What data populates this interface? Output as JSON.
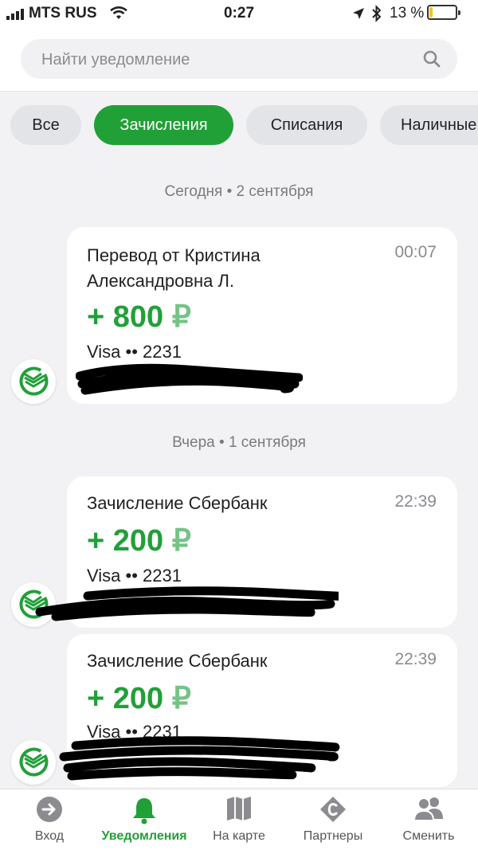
{
  "status_bar": {
    "carrier": "MTS RUS",
    "time": "0:27",
    "battery": "13 %",
    "battery_level": 0.13
  },
  "search": {
    "placeholder": "Найти уведомление",
    "value": ""
  },
  "filters": [
    {
      "label": "Все",
      "active": false
    },
    {
      "label": "Зачисления",
      "active": true
    },
    {
      "label": "Списания",
      "active": false
    },
    {
      "label": "Наличные",
      "active": false
    }
  ],
  "groups": [
    {
      "date": "Сегодня • 2 сентября",
      "items": [
        {
          "title_line1": "Перевод от Кристина",
          "title_line2": "Александровна Л.",
          "time": "00:07",
          "amount": "+ 800",
          "currency": "₽",
          "card": "Visa •• 2231"
        }
      ]
    },
    {
      "date": "Вчера • 1 сентября",
      "items": [
        {
          "title": "Зачисление Сбербанк",
          "time": "22:39",
          "amount": "+ 200",
          "currency": "₽",
          "card": "Visa •• 2231"
        },
        {
          "title": "Зачисление Сбербанк",
          "time": "22:39",
          "amount": "+ 200",
          "currency": "₽",
          "card": "Visa •• 2231"
        }
      ]
    }
  ],
  "tabbar": [
    {
      "label": "Вход",
      "icon": "login-arrow-icon",
      "active": false
    },
    {
      "label": "Уведомления",
      "icon": "bell-icon",
      "active": true
    },
    {
      "label": "На карте",
      "icon": "map-icon",
      "active": false
    },
    {
      "label": "Партнеры",
      "icon": "partners-icon",
      "active": false
    },
    {
      "label": "Сменить",
      "icon": "users-icon",
      "active": false
    }
  ],
  "colors": {
    "accent": "#21a038",
    "accent_light": "#77c287",
    "background": "#f2f2f4",
    "chip_inactive": "#e3e4e8",
    "battery": "#f7c600"
  }
}
